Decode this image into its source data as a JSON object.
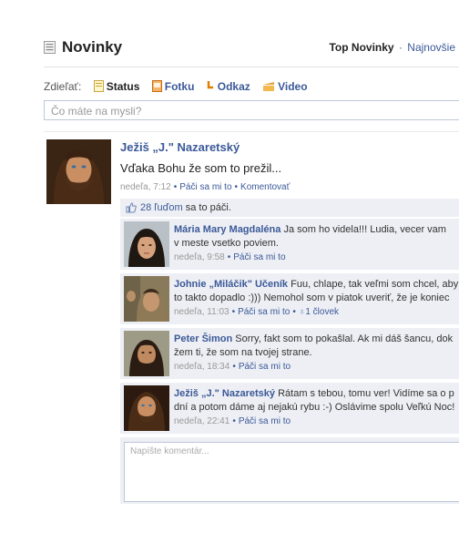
{
  "header": {
    "title": "Novinky",
    "top_news": "Top Novinky",
    "separator": "·",
    "newest": "Najnovšie"
  },
  "share": {
    "label": "Zdieľať:",
    "items": [
      "Status",
      "Fotku",
      "Odkaz",
      "Video"
    ],
    "placeholder": "Čo máte na mysli?"
  },
  "post": {
    "author": "Ježiš „J.\" Nazaretský",
    "text": "Vďaka Bohu že som to prežil...",
    "time": "nedeľa, 7:12",
    "like": "Páči sa mi to",
    "comment": "Komentovať",
    "likes_count": "28 ľuďom",
    "likes_rest": "sa to páči."
  },
  "comments": [
    {
      "author": "Mária Mary Magdaléna",
      "line1": "Ja som ho videla!!! Ludia, vecer vam",
      "line2": "v meste vsetko poviem.",
      "time": "nedeľa, 9:58",
      "like": "Páči sa mi to",
      "likes": ""
    },
    {
      "author": "Johnie „Miláčik\" Učeník",
      "line1": "Fuu, chlape, tak veľmi som chcel, aby",
      "line2": "to takto dopadlo :))) Nemohol som v piatok uveriť, že je koniec",
      "time": "nedeľa, 11:03",
      "like": "Páči sa mi to",
      "likes": "1 človek"
    },
    {
      "author": "Peter Šimon",
      "line1": "Sorry, fakt som to pokašlal. Ak mi dáš šancu, dok",
      "line2": "žem ti, že som na tvojej strane.",
      "time": "nedeľa, 18:34",
      "like": "Páči sa mi to",
      "likes": ""
    },
    {
      "author": "Ježiš „J.\" Nazaretský",
      "line1": "Rátam s tebou, tomu ver! Vidíme sa o p",
      "line2": "dní a potom dáme aj nejakú rybu :-) Oslávime spolu Veľkú Noc!",
      "time": "nedeľa, 22:41",
      "like": "Páči sa mi to",
      "likes": ""
    }
  ],
  "comment_box": {
    "placeholder": "Napíšte komentár..."
  },
  "colors": {
    "link": "#3b5998",
    "feedback_bg": "#edeff4",
    "input_border": "#bdc7d8"
  }
}
